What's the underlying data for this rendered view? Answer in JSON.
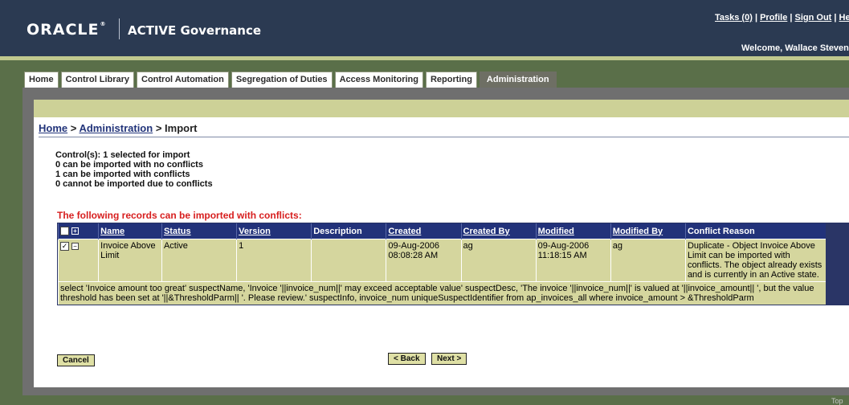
{
  "header": {
    "logo": "ORACLE",
    "logo_reg": "®",
    "product": "ACTIVE Governance",
    "links": [
      "Tasks (0)",
      "Profile",
      "Sign Out",
      "Help"
    ],
    "link_sep": "|",
    "welcome": "Welcome, Wallace Stevens"
  },
  "tabs": [
    "Home",
    "Control Library",
    "Control Automation",
    "Segregation of Duties",
    "Access Monitoring",
    "Reporting",
    "Administration"
  ],
  "active_tab": "Administration",
  "breadcrumb": {
    "home": "Home",
    "sep": " > ",
    "admin": "Administration",
    "current": "Import"
  },
  "summary": [
    "Control(s): 1 selected for import",
    "0 can be imported with no conflicts",
    "1 can be imported with conflicts",
    "0 cannot be imported due to conflicts"
  ],
  "conflict_heading": "The following records can be imported with conflicts:",
  "table": {
    "columns": [
      "Name",
      "Status",
      "Version",
      "Description",
      "Created",
      "Created By",
      "Modified",
      "Modified By",
      "Conflict Reason"
    ],
    "rows": [
      {
        "checked": true,
        "expanded": true,
        "name": "Invoice Above Limit",
        "status": "Active",
        "version": "1",
        "description": "",
        "created": "09-Aug-2006 08:08:28 AM",
        "created_by": "ag",
        "modified": "09-Aug-2006 11:18:15 AM",
        "modified_by": "ag",
        "conflict_reason": "Duplicate - Object Invoice Above Limit can be imported with conflicts. The object already exists and is currently in an Active state.",
        "detail": "select 'Invoice amount too great' suspectName, 'Invoice '||invoice_num||' may exceed acceptable value' suspectDesc, 'The invoice '||invoice_num||' is valued at '||invoice_amount|| ', but the value threshold has been set at '||&ThresholdParm|| '. Please review.' suspectInfo, invoice_num uniqueSuspectIdentifier from ap_invoices_all where invoice_amount > &ThresholdParm"
      }
    ]
  },
  "buttons": {
    "cancel": "Cancel",
    "back": "< Back",
    "next": "Next >"
  },
  "footer": {
    "top": "Top"
  }
}
